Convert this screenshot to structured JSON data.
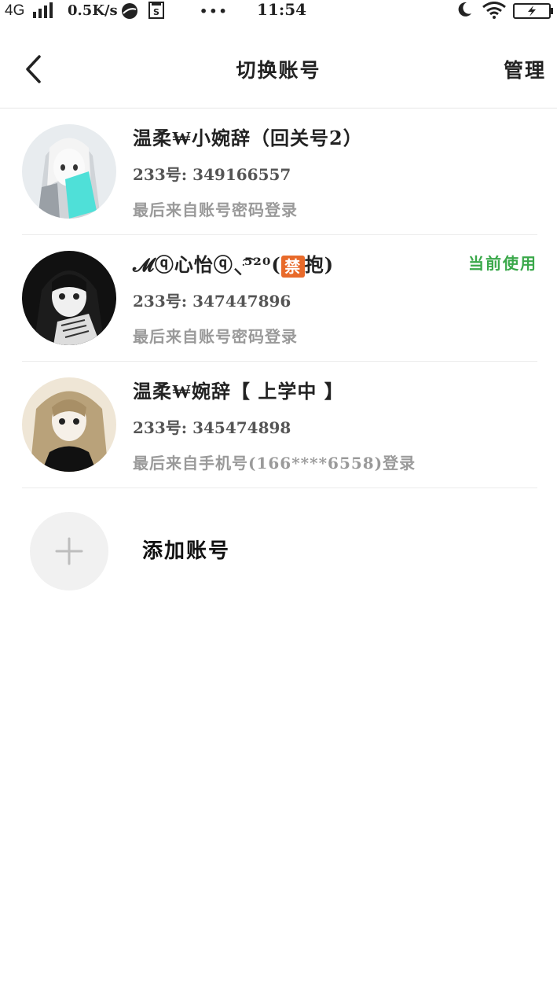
{
  "status_bar": {
    "network": "4G",
    "speed": "0.5K/s",
    "dots": "•••",
    "time": "11:54"
  },
  "header": {
    "title": "切换账号",
    "manage": "管理"
  },
  "accounts": [
    {
      "name": "温柔₩小婉辞（回关号2）",
      "uid": "233号: 349166557",
      "login": "最后来自账号密码登录",
      "current": ""
    },
    {
      "name_prefix": "𝓜ⓠ心怡ⓠ⸜ּ͡",
      "name_suffix": "⁵²⁰(",
      "ban_icon": "禁",
      "name_end": "抱)",
      "uid": "233号: 347447896",
      "login": "最后来自账号密码登录",
      "current": "当前使用"
    },
    {
      "name": "温柔₩婉辞【 上学中 】",
      "uid": "233号: 345474898",
      "login": "最后来自手机号(166****6558)登录",
      "current": ""
    }
  ],
  "add_account": {
    "label": "添加账号",
    "icon": "plus-icon"
  },
  "colors": {
    "current": "#3aa84a",
    "muted": "#9a9a9a",
    "divider": "#ececec"
  }
}
